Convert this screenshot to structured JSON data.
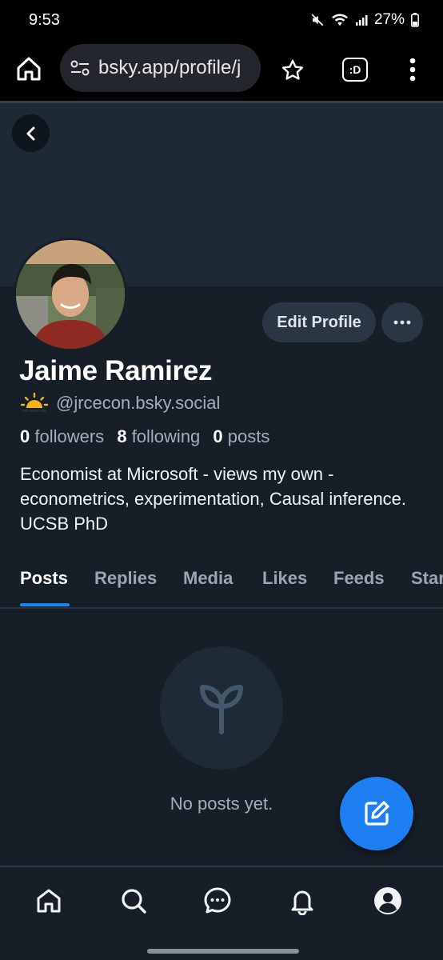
{
  "status_bar": {
    "time": "9:53",
    "battery": "27%"
  },
  "browser": {
    "url": "bsky.app/profile/j",
    "tabs_label": ":D"
  },
  "profile": {
    "display_name": "Jaime Ramirez",
    "handle": "@jrcecon.bsky.social",
    "followers_count": "0",
    "followers_label": "followers",
    "following_count": "8",
    "following_label": "following",
    "posts_count": "0",
    "posts_label": "posts",
    "bio": "Economist at Microsoft - views my own - econometrics, experimentation, Causal inference. UCSB PhD",
    "edit_label": "Edit Profile"
  },
  "tabs": [
    {
      "label": "Posts",
      "active": true
    },
    {
      "label": "Replies"
    },
    {
      "label": "Media"
    },
    {
      "label": "Likes"
    },
    {
      "label": "Feeds"
    },
    {
      "label": "Starter Packs"
    }
  ],
  "empty_state": {
    "message": "No posts yet.",
    "icon": "sprout-icon"
  },
  "colors": {
    "background": "#161e27",
    "banner": "#1e2936",
    "accent": "#1d85f5",
    "fab": "#1d7ff2",
    "muted_text": "#a3afbd"
  },
  "nav": [
    "home-icon",
    "search-icon",
    "chat-icon",
    "bell-icon",
    "profile-icon"
  ]
}
